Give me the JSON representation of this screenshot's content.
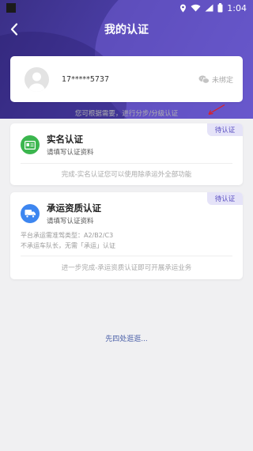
{
  "statusbar": {
    "time": "1:04"
  },
  "header": {
    "title": "我的认证"
  },
  "user": {
    "phone": "17*****5737",
    "wechat_status": "未绑定"
  },
  "hint": "您可根据需要，进行分步/分级认证",
  "certs": [
    {
      "title": "实名认证",
      "subtitle": "请填写认证资料",
      "tag": "待认证",
      "footer": "完成-实名认证您可以使用除承运外全部功能"
    },
    {
      "title": "承运资质认证",
      "subtitle": "请填写认证资料",
      "tag": "待认证",
      "req1": "平台承运需准驾类型：A2/B2/C3",
      "req2": "不承运车队长，无需「承运」认证",
      "footer": "进一步完成-承运资质认证即可开展承运业务"
    }
  ],
  "bottom_link": "先四处逛逛...",
  "colors": {
    "accent": "#4b3ea6",
    "green": "#3bb64e",
    "blue": "#3d86f0",
    "arrow": "#e02020"
  }
}
